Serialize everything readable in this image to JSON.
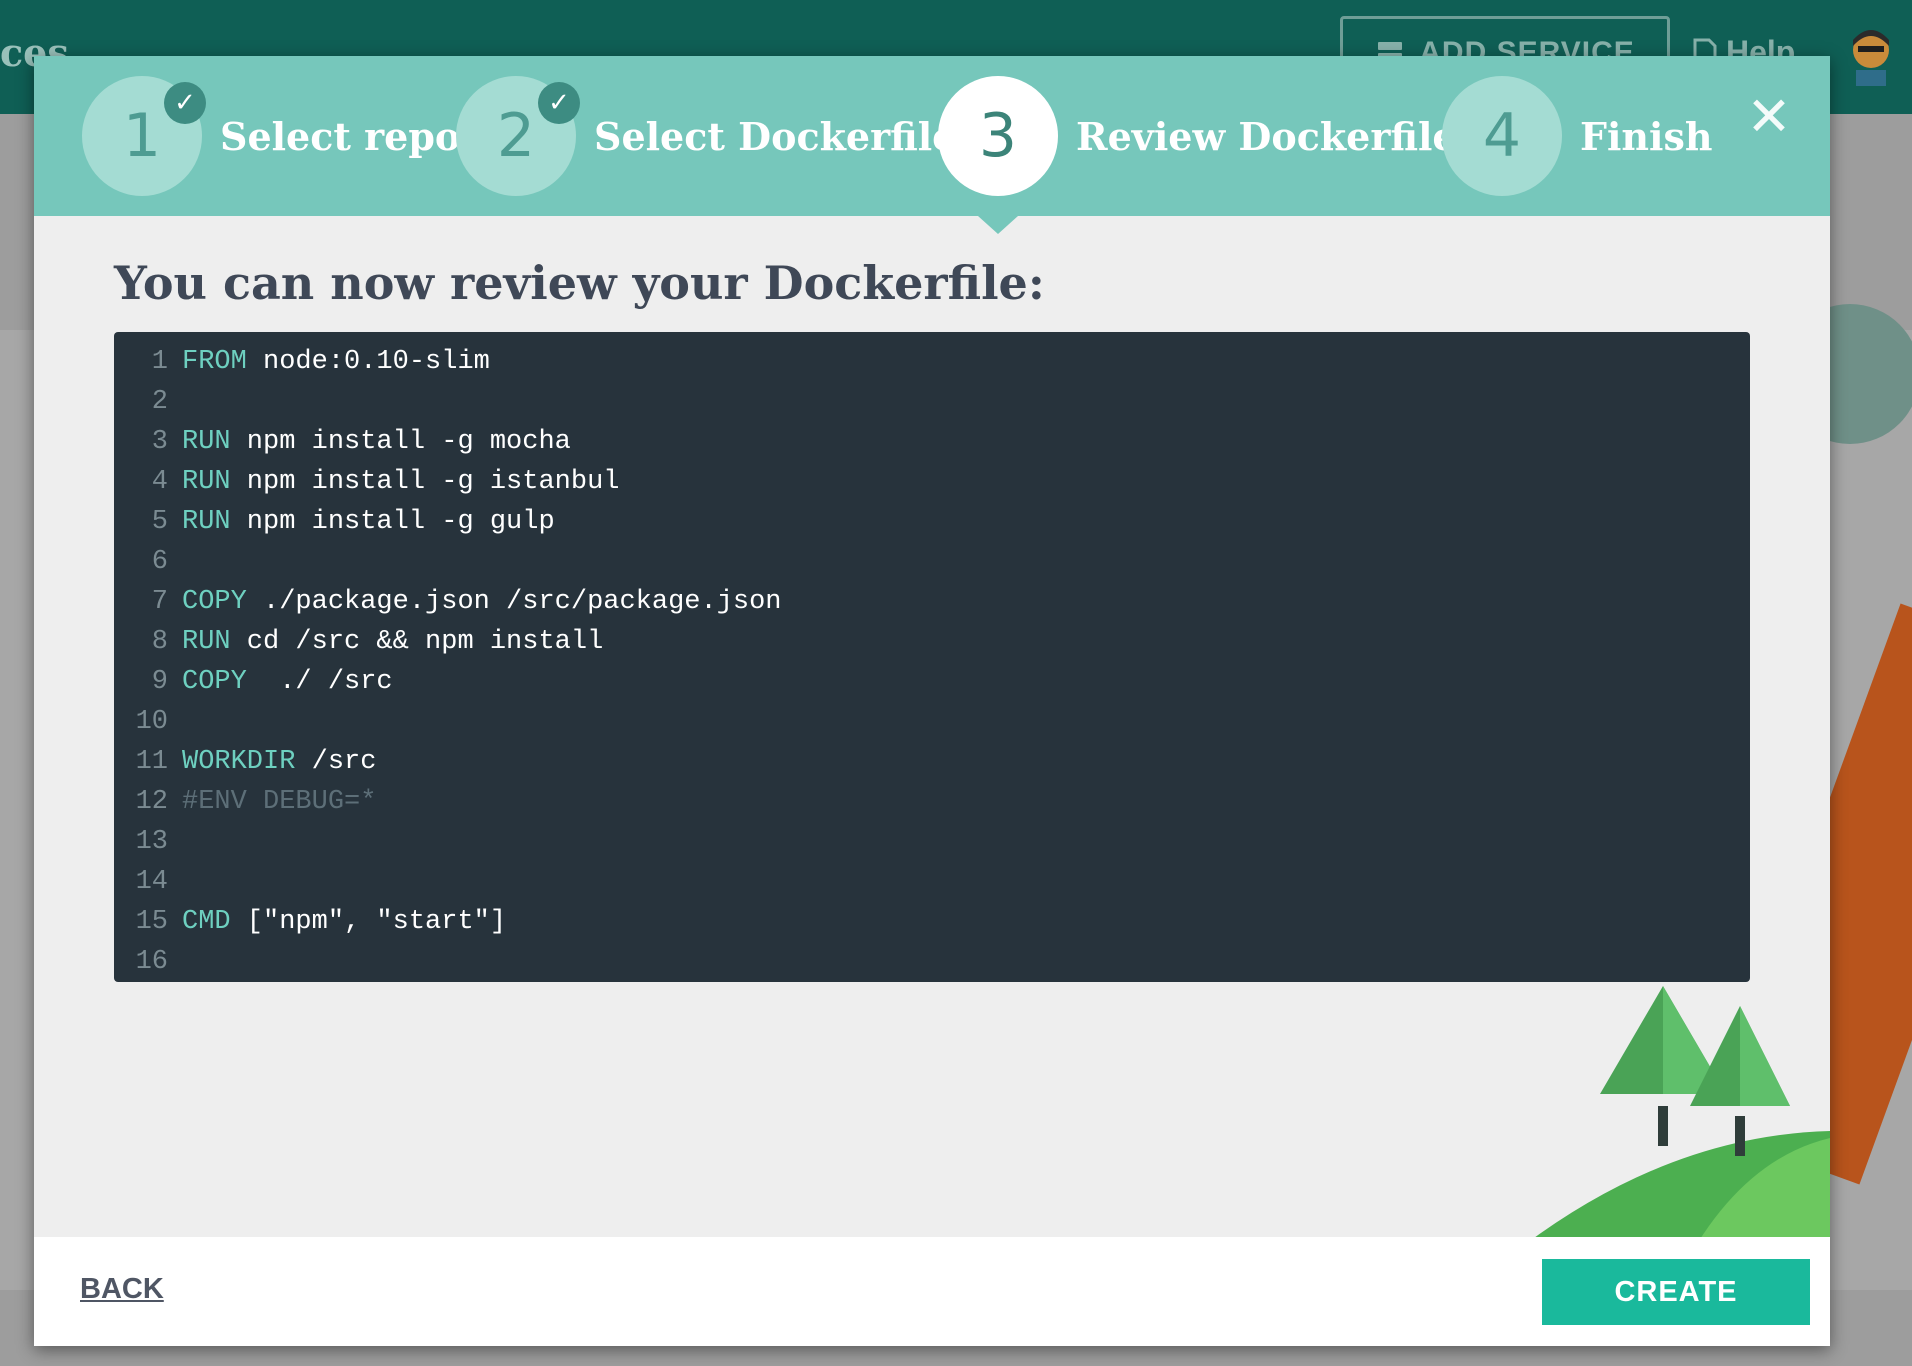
{
  "background": {
    "title_fragment": "ces",
    "add_service_label": "ADD SERVICE",
    "help_label": "Help"
  },
  "wizard": {
    "steps": [
      {
        "number": "1",
        "label": "Select repo",
        "state": "done"
      },
      {
        "number": "2",
        "label": "Select Dockerfile",
        "state": "done"
      },
      {
        "number": "3",
        "label": "Review Dockerfile",
        "state": "active"
      },
      {
        "number": "4",
        "label": "Finish",
        "state": "pending"
      }
    ],
    "check_glyph": "✓",
    "close_glyph": "✕",
    "heading": "You can now review your Dockerfile:"
  },
  "editor": {
    "lines": [
      {
        "n": "1",
        "kw": "FROM",
        "rest": " node:0.10-slim",
        "comment": ""
      },
      {
        "n": "2",
        "kw": "",
        "rest": "",
        "comment": ""
      },
      {
        "n": "3",
        "kw": "RUN",
        "rest": " npm install -g mocha",
        "comment": ""
      },
      {
        "n": "4",
        "kw": "RUN",
        "rest": " npm install -g istanbul",
        "comment": ""
      },
      {
        "n": "5",
        "kw": "RUN",
        "rest": " npm install -g gulp",
        "comment": ""
      },
      {
        "n": "6",
        "kw": "",
        "rest": "",
        "comment": ""
      },
      {
        "n": "7",
        "kw": "COPY",
        "rest": " ./package.json /src/package.json",
        "comment": ""
      },
      {
        "n": "8",
        "kw": "RUN",
        "rest": " cd /src && npm install",
        "comment": ""
      },
      {
        "n": "9",
        "kw": "COPY",
        "rest": "  ./ /src",
        "comment": ""
      },
      {
        "n": "10",
        "kw": "",
        "rest": "",
        "comment": ""
      },
      {
        "n": "11",
        "kw": "WORKDIR",
        "rest": " /src",
        "comment": ""
      },
      {
        "n": "12",
        "kw": "",
        "rest": "",
        "comment": "#ENV DEBUG=*"
      },
      {
        "n": "13",
        "kw": "",
        "rest": "",
        "comment": ""
      },
      {
        "n": "14",
        "kw": "",
        "rest": "",
        "comment": ""
      },
      {
        "n": "15",
        "kw": "CMD",
        "rest": " [\"npm\", \"start\"]",
        "comment": ""
      },
      {
        "n": "16",
        "kw": "",
        "rest": "",
        "comment": ""
      }
    ]
  },
  "footer": {
    "back_label": "BACK",
    "create_label": "CREATE"
  },
  "colors": {
    "header": "#0f5f55",
    "step_bar": "#76c7bb",
    "editor_bg": "#27333c",
    "keyword": "#6ed0c0",
    "create_button": "#1ab99c"
  }
}
